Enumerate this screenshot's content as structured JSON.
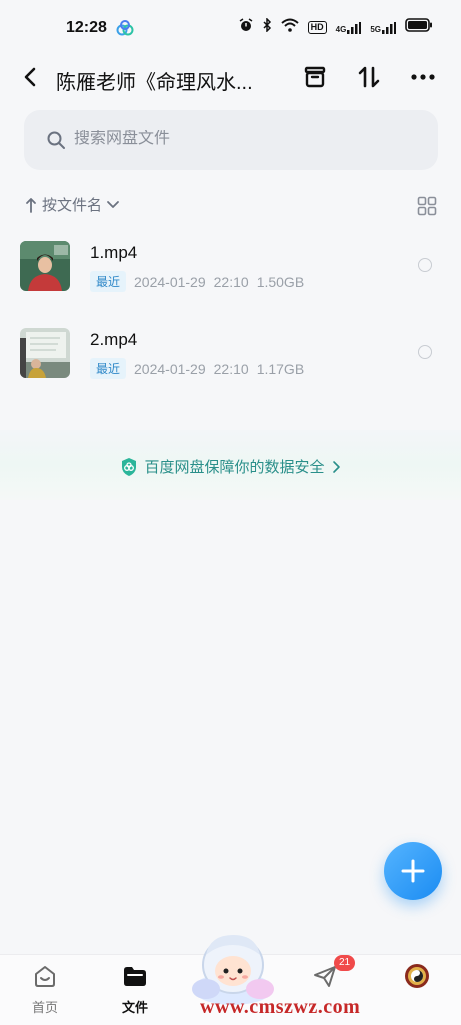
{
  "status_bar": {
    "time": "12:28",
    "hd": "HD",
    "net1": "4G",
    "net2": "5G"
  },
  "header": {
    "title": "陈雁老师《命理风水..."
  },
  "search": {
    "placeholder": "搜索网盘文件"
  },
  "sort": {
    "label": "按文件名"
  },
  "files": [
    {
      "name": "1.mp4",
      "badge": "最近",
      "date": "2024-01-29",
      "time": "22:10",
      "size": "1.50GB"
    },
    {
      "name": "2.mp4",
      "badge": "最近",
      "date": "2024-01-29",
      "time": "22:10",
      "size": "1.17GB"
    }
  ],
  "banner": {
    "text": "百度网盘保障你的数据安全"
  },
  "nav": [
    {
      "label": "首页",
      "icon": "home-face-icon"
    },
    {
      "label": "文件",
      "icon": "folder-icon"
    },
    {
      "label": "",
      "icon": "mascot-icon"
    },
    {
      "label": "",
      "icon": "send-icon",
      "badge": "21"
    },
    {
      "label": "",
      "icon": "avatar-icon"
    }
  ],
  "watermark": "www.cmszwz.com",
  "colors": {
    "accent": "#1b8cf2",
    "safety": "#2a8f8a",
    "badge_bg": "#e6f3fb",
    "badge_text": "#2f88c8"
  }
}
